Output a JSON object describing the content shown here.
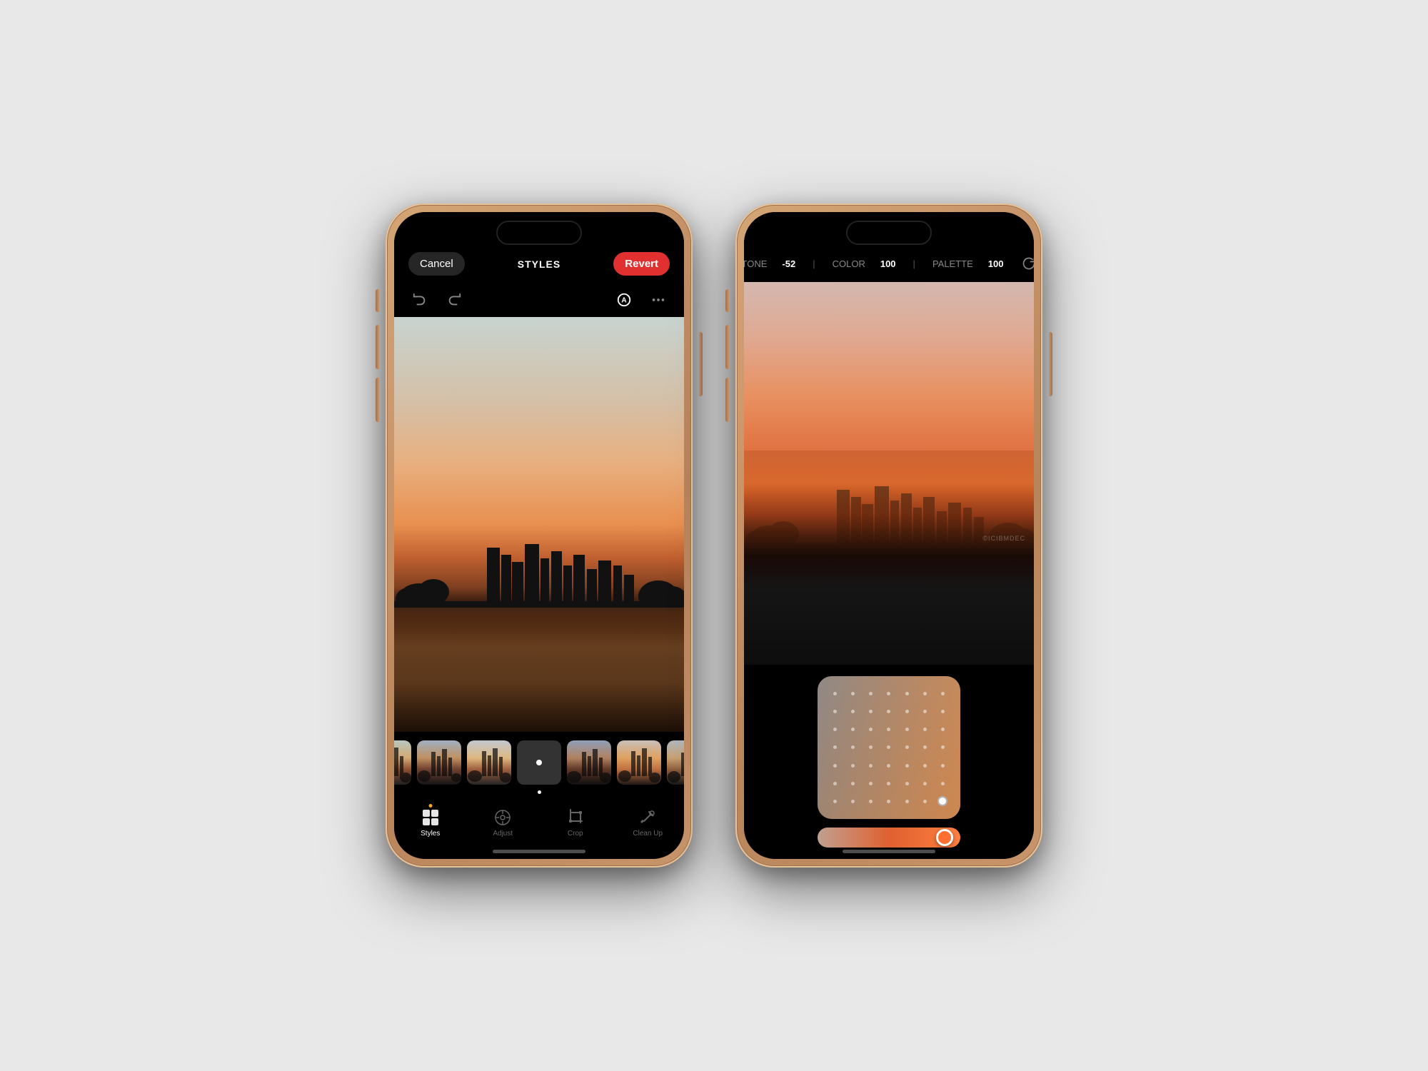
{
  "phone1": {
    "toolbar": {
      "cancel_label": "Cancel",
      "revert_label": "Revert",
      "title": "STYLES"
    },
    "tabs": [
      {
        "id": "styles",
        "label": "Styles",
        "icon": "⊞",
        "active": true
      },
      {
        "id": "adjust",
        "label": "Adjust",
        "icon": "⊙"
      },
      {
        "id": "crop",
        "label": "Crop",
        "icon": "⊡"
      },
      {
        "id": "cleanup",
        "label": "Clean Up",
        "icon": "◇"
      }
    ],
    "style_thumbnails": [
      {
        "id": 1
      },
      {
        "id": 2
      },
      {
        "id": 3
      },
      {
        "id": 0,
        "type": "dot"
      },
      {
        "id": 4
      },
      {
        "id": 5
      },
      {
        "id": 6
      }
    ]
  },
  "phone2": {
    "toolbar": {
      "tone_label": "TONE",
      "tone_value": "-52",
      "color_label": "COLOR",
      "color_value": "100",
      "palette_label": "PALETTE",
      "palette_value": "100"
    },
    "watermark": "©ICIBMDEC"
  },
  "icons": {
    "undo": "↩",
    "redo": "↪",
    "auto": "Ⓐ",
    "more": "⋯",
    "reset": "↺"
  }
}
